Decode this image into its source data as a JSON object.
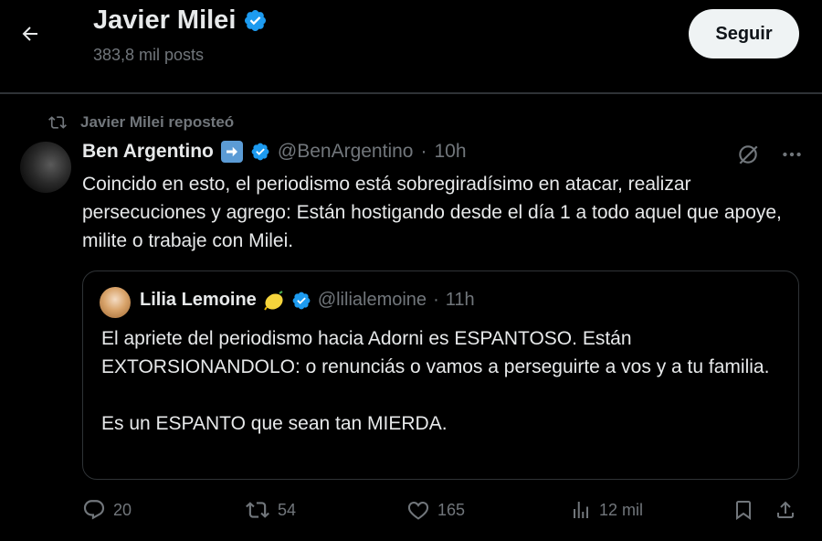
{
  "header": {
    "name": "Javier Milei",
    "posts": "383,8 mil posts",
    "follow_label": "Seguir"
  },
  "repost": {
    "text": "Javier Milei reposteó"
  },
  "tweet": {
    "author": "Ben Argentino",
    "handle": "@BenArgentino",
    "separator": "·",
    "time": "10h",
    "text": "Coincido en esto, el periodismo está sobregiradísimo en atacar, realizar persecuciones y agrego: Están hostigando desde el día 1 a todo aquel que apoye, milite o trabaje con Milei."
  },
  "quote": {
    "author": "Lilia Lemoine",
    "handle": "@lilialemoine",
    "separator": "·",
    "time": "11h",
    "paragraph1": "El apriete del periodismo hacia Adorni es ESPANTOSO. Están EXTORSIONANDOLO: o renunciás o vamos a perseguirte a vos y a tu familia.",
    "paragraph2": "Es un ESPANTO que sean tan MIERDA."
  },
  "actions": {
    "replies": "20",
    "reposts": "54",
    "likes": "165",
    "views": "12 mil"
  },
  "colors": {
    "background": "#000000",
    "text": "#e7e9ea",
    "muted": "#71767b",
    "verified": "#1d9bf0",
    "border": "#2f3336",
    "follow_bg": "#eff3f4"
  },
  "icons": [
    "back-arrow-icon",
    "verified-badge-icon",
    "repost-icon",
    "arrow-right-emoji-icon",
    "lemon-emoji-icon",
    "grok-icon",
    "more-icon",
    "reply-icon",
    "like-icon",
    "views-icon",
    "bookmark-icon",
    "share-icon"
  ]
}
